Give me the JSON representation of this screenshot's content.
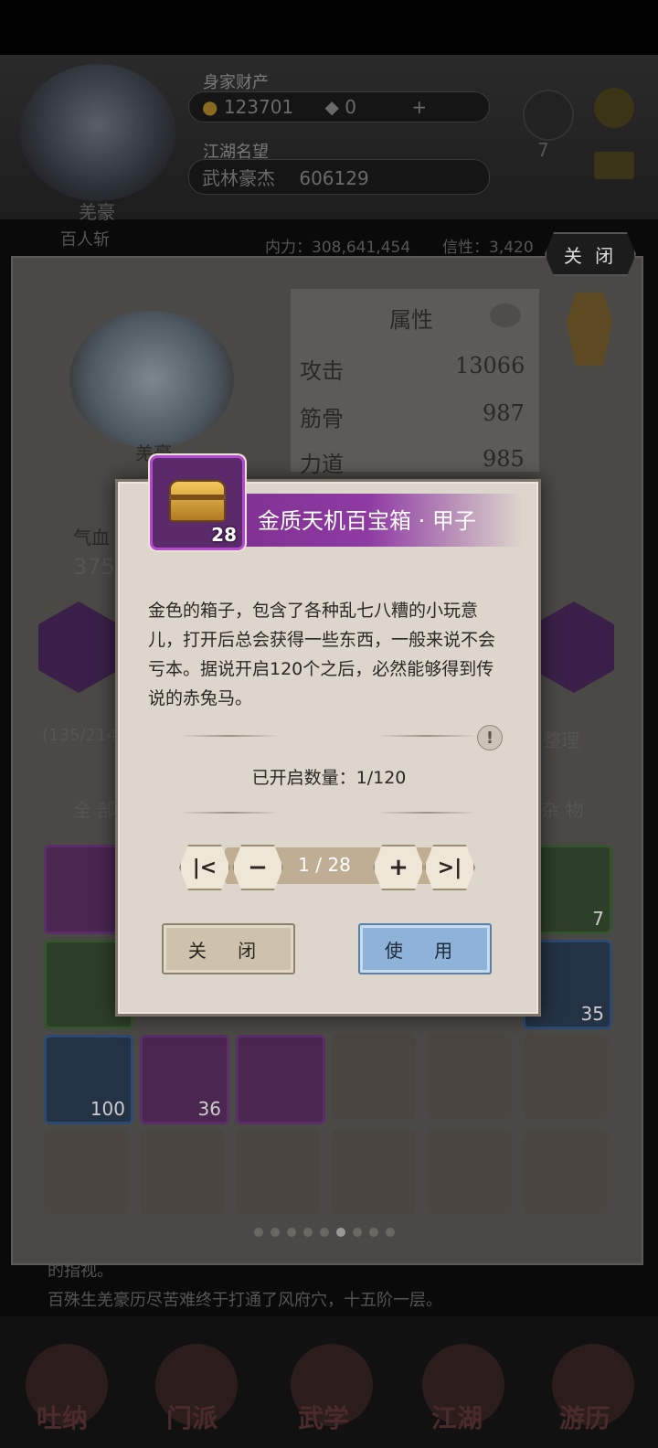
{
  "header": {
    "label_wealth": "身家财产",
    "gold": "123701",
    "jade": "0",
    "plus": "+",
    "label_fame": "江湖名望",
    "fame_title": "武林豪杰",
    "fame_value": "606129",
    "char_name": "羌豪",
    "char_tag": "百人斩",
    "level_badge": "7"
  },
  "background": {
    "power_text": "内力：308,641,454",
    "other_text": "信性：3,420",
    "close_label": "关 闭",
    "stats_title": "属性",
    "stats": [
      {
        "name": "攻击",
        "value": "13066"
      },
      {
        "name": "筋骨",
        "value": "987"
      },
      {
        "name": "力道",
        "value": "985"
      }
    ],
    "char_name": "羌豪",
    "qixue_label": "气血",
    "qixue_value": "375",
    "bag_count": "(135/214",
    "sort_label": "整理",
    "filter_all": "全 部",
    "filter_misc": "杂 物",
    "grid_counts": {
      "c1": "7",
      "c2": "35",
      "c3": "100",
      "c4": "36"
    },
    "log_line1": "的指视。",
    "log_line2": "百殊生羌豪历尽苦难终于打通了风府穴，十五阶一层。",
    "nav": [
      "吐纳",
      "门派",
      "武学",
      "江湖",
      "游历"
    ]
  },
  "modal": {
    "item_name": "金质天机百宝箱 · 甲子",
    "item_count": "28",
    "description": "金色的箱子，包含了各种乱七八糟的小玩意儿，打开后总会获得一些东西，一般来说不会亏本。据说开启120个之后，必然能够得到传说的赤兔马。",
    "info_icon": "!",
    "opened_text": "已开启数量：1/120",
    "page_text": "1 / 28",
    "first_symbol": "|<",
    "minus_symbol": "−",
    "plus_symbol": "+",
    "last_symbol": ">|",
    "close_button": "关 闭",
    "use_button": "使 用"
  },
  "pagination": {
    "total_dots": 9,
    "active_dot": 6
  },
  "colors": {
    "accent_purple": "#8e3aa2",
    "use_blue": "#8fb2d8",
    "modal_bg": "#ddd6cc"
  }
}
